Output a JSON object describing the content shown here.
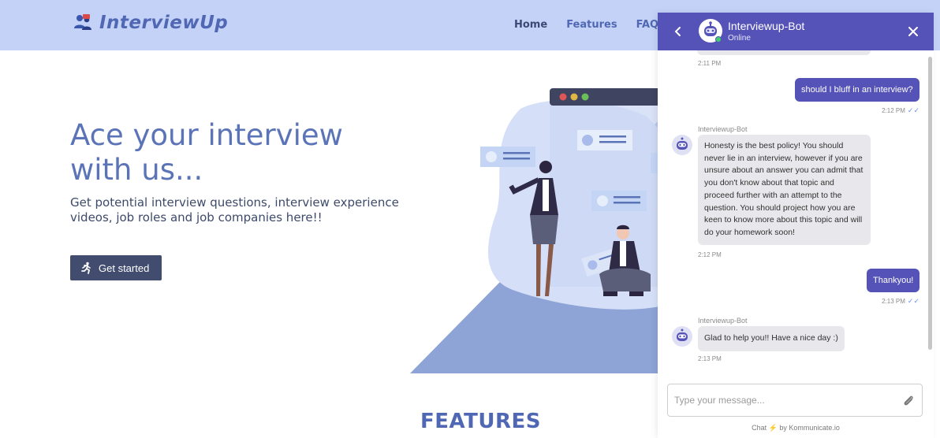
{
  "brand": {
    "name": "InterviewUp"
  },
  "nav": {
    "home": "Home",
    "features": "Features",
    "faqs": "FAQs"
  },
  "hero": {
    "title_line1": "Ace your interview",
    "title_line2": "with us...",
    "subtitle": "Get potential interview questions, interview experience videos, job roles and job companies here!!",
    "cta_label": "Get started"
  },
  "features_heading": "FEATURES",
  "chat": {
    "bot_name": "Interviewup-Bot",
    "status": "Online",
    "messages": [
      {
        "type": "time",
        "text": "2:11 PM"
      },
      {
        "type": "out",
        "text": "should I bluff in an interview?",
        "time": "2:12 PM"
      },
      {
        "type": "in",
        "sender": "Interviewup-Bot",
        "text": "Honesty is the best policy! You should never lie in an interview, however if you are unsure about an answer you can admit that you don't know about that topic and proceed further with an attempt to the question. You should project how you are keen to know more about this topic and will do your homework soon!",
        "time": "2:12 PM"
      },
      {
        "type": "out",
        "text": "Thankyou!",
        "time": "2:13 PM"
      },
      {
        "type": "in",
        "sender": "Interviewup-Bot",
        "text": "Glad to help you!! Have a nice day :)",
        "time": "2:13 PM"
      }
    ],
    "input_placeholder": "Type your message...",
    "powered_prefix": "Chat",
    "powered_suffix": "by Kommunicate.io"
  },
  "colors": {
    "navbar": "#c4d2f7",
    "brand": "#5068b3",
    "chat_header": "#5553b7",
    "cta": "#414c6e"
  },
  "icons": [
    "users-icon",
    "runner-icon",
    "back-arrow-icon",
    "close-icon",
    "bot-avatar-icon",
    "attach-icon",
    "bolt-icon",
    "double-check-icon"
  ]
}
